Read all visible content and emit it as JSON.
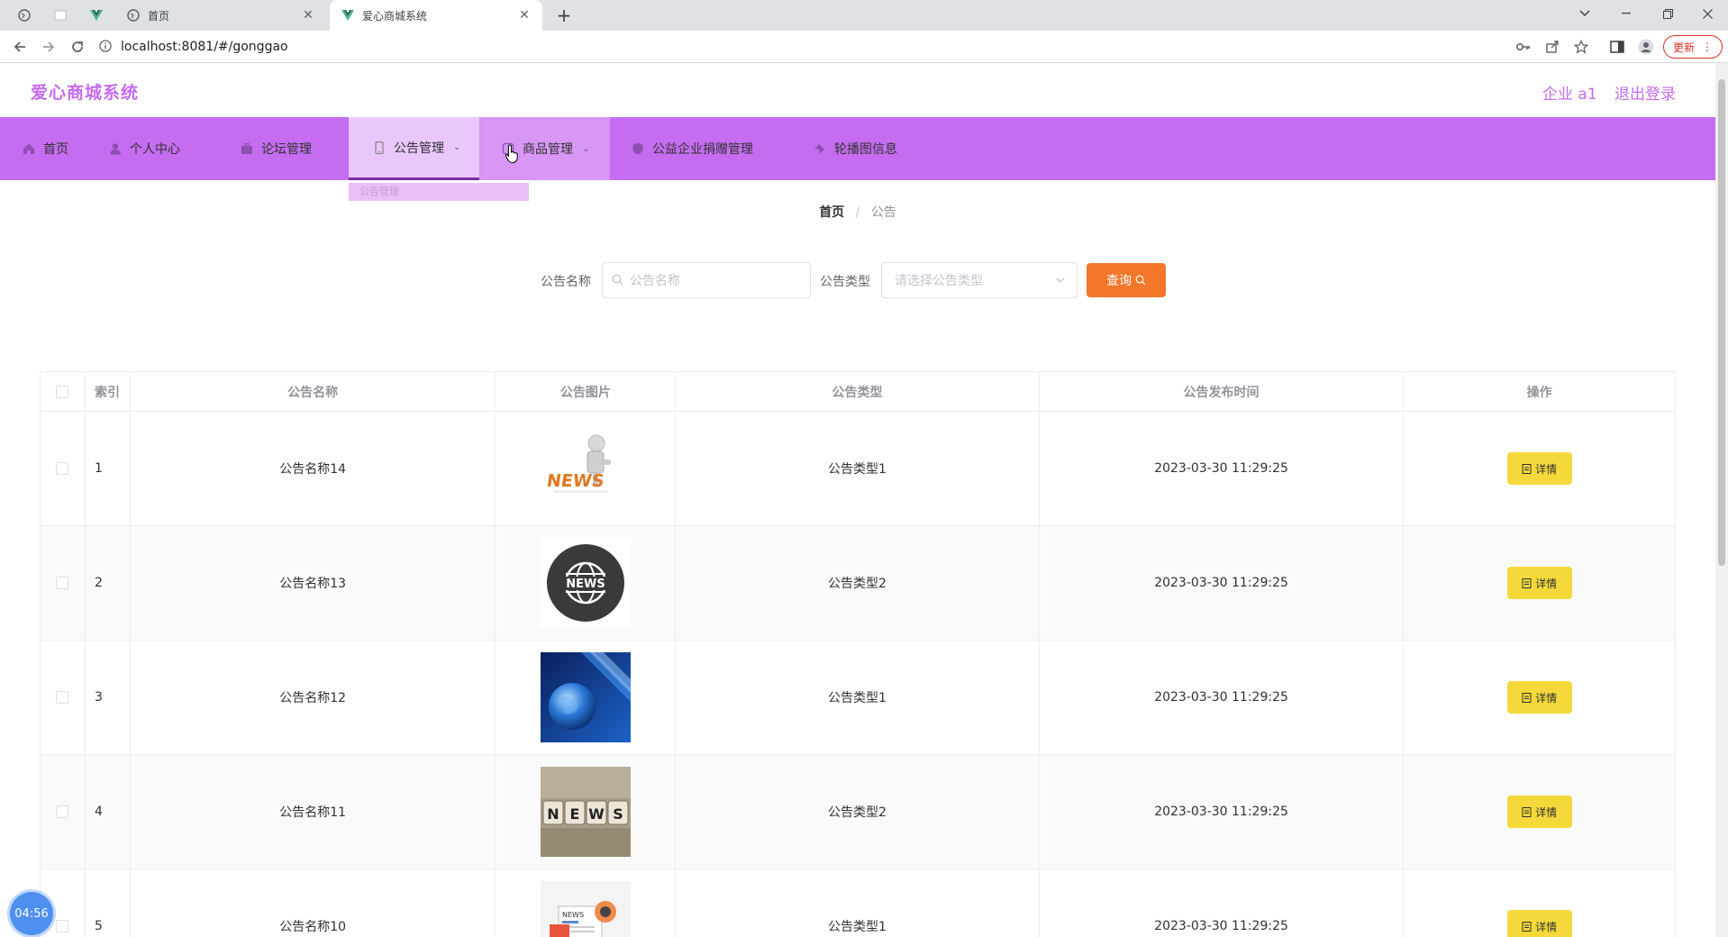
{
  "browser": {
    "tabs": [
      {
        "title": "首页",
        "active": false
      },
      {
        "title": "爱心商城系统",
        "active": true
      }
    ],
    "url": "localhost:8081/#/gonggao",
    "update_label": "更新"
  },
  "header": {
    "brand": "爱心商城系统",
    "user": "企业 a1",
    "logout": "退出登录"
  },
  "nav": {
    "items": [
      {
        "label": "首页",
        "icon": "home-icon"
      },
      {
        "label": "个人中心",
        "icon": "user-icon"
      },
      {
        "label": "论坛管理",
        "icon": "briefcase-icon"
      },
      {
        "label": "公告管理",
        "icon": "mobile-icon"
      },
      {
        "label": "商品管理",
        "icon": "product-icon"
      },
      {
        "label": "公益企业捐赠管理",
        "icon": "shield-icon"
      },
      {
        "label": "轮播图信息",
        "icon": "pin-icon"
      }
    ],
    "submenu_label": "公告管理"
  },
  "breadcrumb": {
    "home": "首页",
    "separator": "/",
    "current": "公告"
  },
  "search": {
    "name_label": "公告名称",
    "name_placeholder": "公告名称",
    "type_label": "公告类型",
    "type_placeholder": "请选择公告类型",
    "query_label": "查询"
  },
  "table": {
    "columns": [
      "索引",
      "公告名称",
      "公告图片",
      "公告类型",
      "公告发布时间",
      "操作"
    ],
    "rows": [
      {
        "index": "1",
        "name": "公告名称14",
        "type": "公告类型1",
        "time": "2023-03-30 11:29:25",
        "image": "news-figure-image"
      },
      {
        "index": "2",
        "name": "公告名称13",
        "type": "公告类型2",
        "time": "2023-03-30 11:29:25",
        "image": "news-globe-badge-image"
      },
      {
        "index": "3",
        "name": "公告名称12",
        "type": "公告类型1",
        "time": "2023-03-30 11:29:25",
        "image": "blue-globe-image"
      },
      {
        "index": "4",
        "name": "公告名称11",
        "type": "公告类型2",
        "time": "2023-03-30 11:29:25",
        "image": "news-cubes-image"
      },
      {
        "index": "5",
        "name": "公告名称10",
        "type": "公告类型1",
        "time": "2023-03-30 11:29:25",
        "image": "newspaper-image"
      }
    ],
    "detail_label": "详情"
  },
  "timer": "04:56",
  "colors": {
    "brand": "#c56cf0",
    "nav_bg": "#c56cf0",
    "query_button": "#f4772a",
    "detail_button": "#f5d93b"
  }
}
